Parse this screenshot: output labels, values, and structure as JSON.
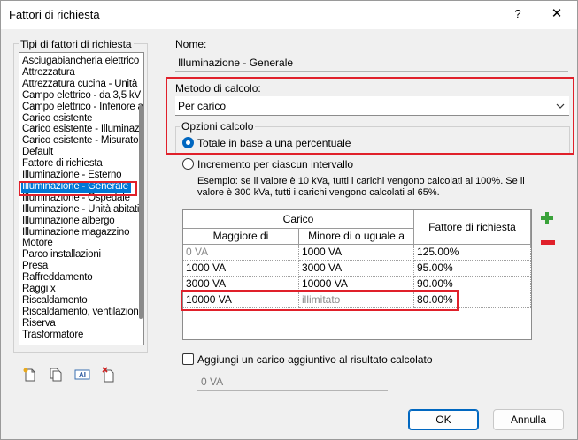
{
  "window": {
    "title": "Fattori di richiesta",
    "help": "?",
    "close": "✕"
  },
  "left_panel": {
    "label": "Tipi di fattori di richiesta",
    "items": [
      "Asciugabiancheria elettrico",
      "Attrezzatura",
      "Attrezzatura cucina - Unità",
      "Campo elettrico - da 3,5 kV",
      "Campo elettrico - Inferiore a",
      "Carico esistente",
      "Carico esistente - Illuminazi",
      "Carico esistente - Misurato",
      "Default",
      "Fattore di richiesta",
      "Illuminazione - Esterno",
      "Illuminazione - Generale",
      "Illuminazione - Ospedale",
      "Illuminazione - Unità abitativ",
      "Illuminazione albergo",
      "Illuminazione magazzino",
      "Motore",
      "Parco installazioni",
      "Presa",
      "Raffreddamento",
      "Raggi x",
      "Riscaldamento",
      "Riscaldamento, ventilazione",
      "Riserva",
      "Trasformatore"
    ],
    "selected_index": 11
  },
  "name": {
    "label": "Nome:",
    "value": "Illuminazione - Generale"
  },
  "method": {
    "label": "Metodo di calcolo:",
    "selected": "Per carico"
  },
  "options": {
    "label": "Opzioni calcolo",
    "radio1": "Totale in base a una percentuale",
    "radio2": "Incremento per ciascun intervallo",
    "example": "Esempio: se il valore è 10 kVa, tutti i carichi vengono calcolati al 100%. Se il valore è 300 kVa, tutti i carichi vengono calcolati al 65%."
  },
  "table": {
    "group_header": "Carico",
    "col_min": "Maggiore di",
    "col_max": "Minore di o uguale a",
    "col_factor": "Fattore di richiesta",
    "rows": [
      {
        "min": "0 VA",
        "max": "1000 VA",
        "factor": "125.00%"
      },
      {
        "min": "1000 VA",
        "max": "3000 VA",
        "factor": "95.00%"
      },
      {
        "min": "3000 VA",
        "max": "10000 VA",
        "factor": "90.00%"
      },
      {
        "min": "10000 VA",
        "max": "illimitato",
        "factor": "80.00%"
      }
    ]
  },
  "additional": {
    "label": "Aggiungi un carico aggiuntivo al risultato calcolato",
    "value": "0 VA"
  },
  "buttons": {
    "ok": "OK",
    "cancel": "Annulla"
  },
  "colors": {
    "highlight": "#e0202a",
    "selection": "#0078d7",
    "add": "#3aa23a",
    "remove": "#e0202a"
  }
}
